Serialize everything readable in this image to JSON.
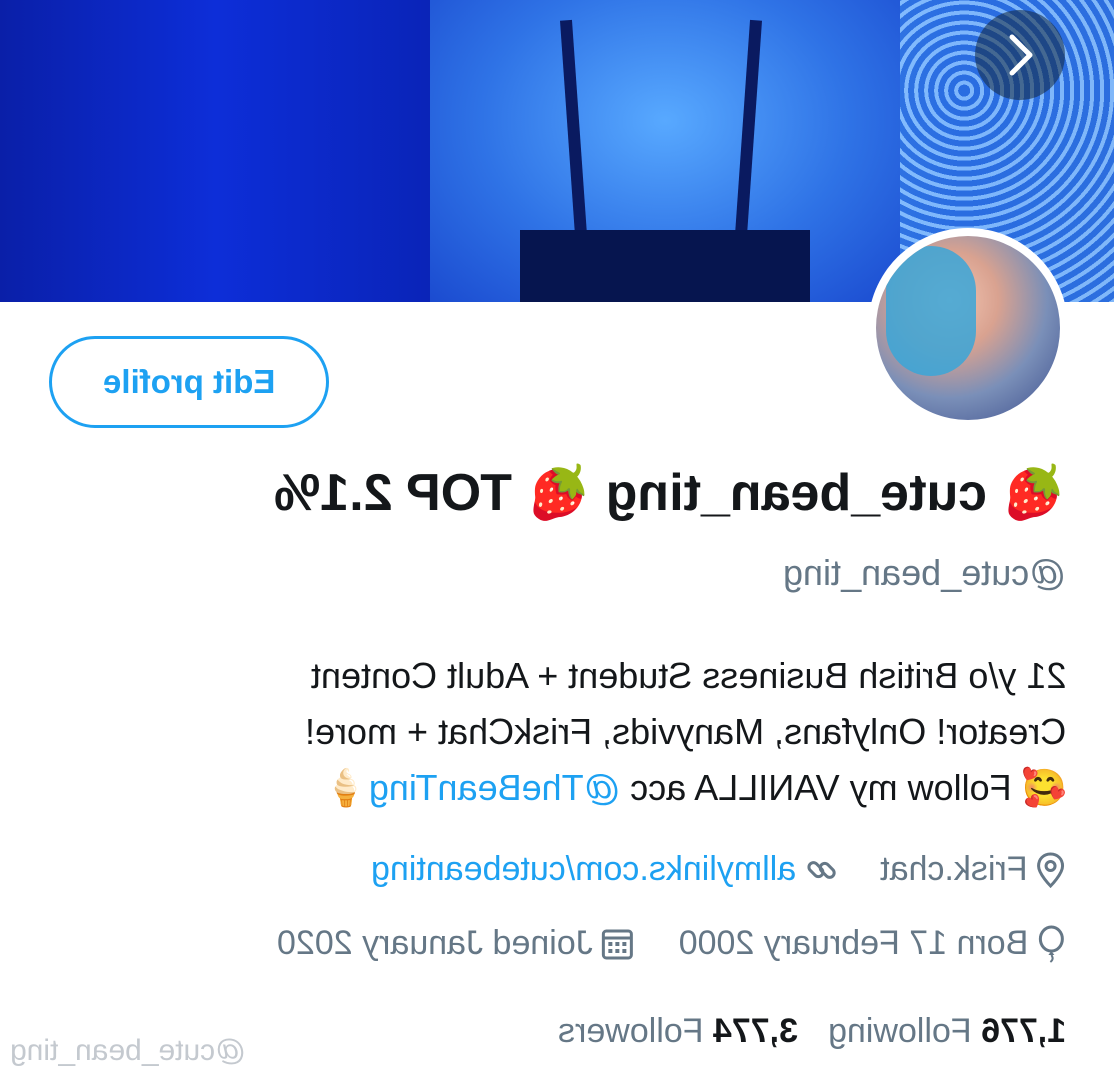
{
  "profile": {
    "display_name": "🍓 cute_bean_ting 🍓 TOP 2.1%",
    "handle": "@cute_bean_ting",
    "edit_button_label": "Edit profile",
    "bio": {
      "line1": "21 y/o British Business Student + Adult Content",
      "line2": "Creator! Onlyfans, Manyvids, FriskChat + more!",
      "line3_emoji_start": "🥰",
      "line3_text": " Follow my VANILLA acc ",
      "line3_mention": "@TheBeanTing",
      "line3_emoji_end": " 🍦"
    },
    "location": "Frisk.chat",
    "website": "allmylinks.com/cutebeanting",
    "born": "Born 17 February 2000",
    "joined": "Joined January 2020",
    "following_count": "1,776",
    "following_label": " Following",
    "followers_count": "3,774",
    "followers_label": " Followers"
  },
  "watermark": "@cute_bean_ting",
  "colors": {
    "accent": "#1da1f2",
    "secondary_text": "#657786",
    "primary_text": "#14171a"
  },
  "icons": {
    "location": "location-pin-icon",
    "website": "link-icon",
    "born": "balloon-icon",
    "joined": "calendar-icon",
    "next": "chevron-right-icon"
  }
}
